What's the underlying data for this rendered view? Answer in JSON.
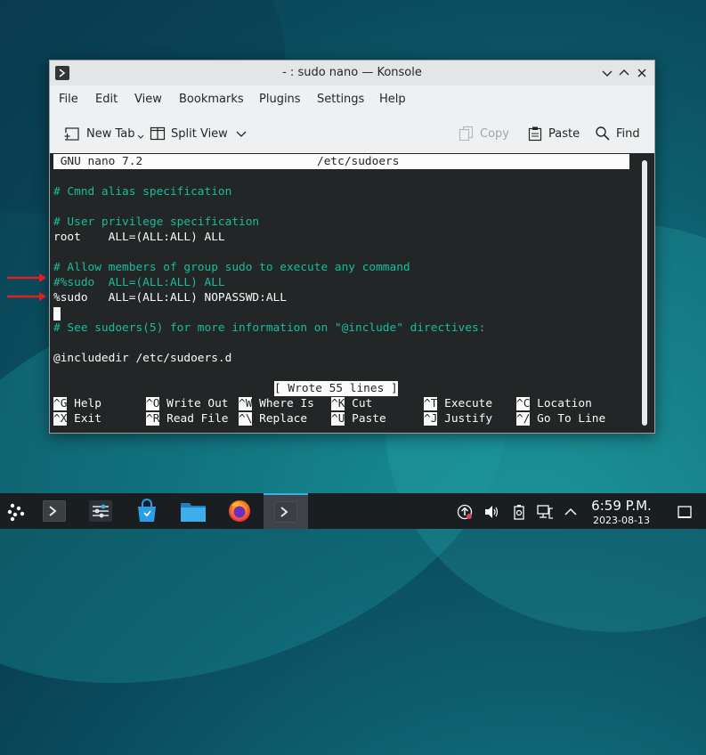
{
  "window": {
    "title": "- : sudo nano — Konsole"
  },
  "menu": [
    "File",
    "Edit",
    "View",
    "Bookmarks",
    "Plugins",
    "Settings",
    "Help"
  ],
  "toolbar": {
    "new_tab": "New Tab",
    "split_view": "Split View",
    "copy": "Copy",
    "paste": "Paste",
    "find": "Find"
  },
  "terminal": {
    "header_left": "GNU nano 7.2",
    "header_file": "/etc/sudoers",
    "lines": [
      {
        "text": "# Cmnd alias specification",
        "type": "comment"
      },
      {
        "text": "# User privilege specification",
        "type": "comment"
      },
      {
        "text": "root    ALL=(ALL:ALL) ALL",
        "type": "normal"
      },
      {
        "text": "# Allow members of group sudo to execute any command",
        "type": "comment"
      },
      {
        "text": "#%sudo  ALL=(ALL:ALL) ALL",
        "type": "comment"
      },
      {
        "text": "%sudo   ALL=(ALL:ALL) NOPASSWD:ALL",
        "type": "normal"
      },
      {
        "text": "# See sudoers(5) for more information on \"@include\" directives:",
        "type": "comment"
      },
      {
        "text": "@includedir /etc/sudoers.d",
        "type": "normal"
      }
    ],
    "status": "[ Wrote 55 lines ]",
    "shortcuts_row1": [
      {
        "key": "^G",
        "label": "Help"
      },
      {
        "key": "^O",
        "label": "Write Out"
      },
      {
        "key": "^W",
        "label": "Where Is"
      },
      {
        "key": "^K",
        "label": "Cut"
      },
      {
        "key": "^T",
        "label": "Execute"
      },
      {
        "key": "^C",
        "label": "Location"
      }
    ],
    "shortcuts_row2": [
      {
        "key": "^X",
        "label": "Exit"
      },
      {
        "key": "^R",
        "label": "Read File"
      },
      {
        "key": "^\\",
        "label": "Replace"
      },
      {
        "key": "^U",
        "label": "Paste"
      },
      {
        "key": "^J",
        "label": "Justify"
      },
      {
        "key": "^/",
        "label": "Go To Line"
      }
    ]
  },
  "taskbar": {
    "time": "6:59 P.M.",
    "date": "2023-08-13",
    "apps": [
      "application-launcher-icon",
      "konsole-icon",
      "system-settings-icon",
      "discover-store-icon",
      "dolphin-files-icon",
      "firefox-icon",
      "konsole-active-icon"
    ]
  },
  "colors": {
    "comment": "#1abc9c",
    "accent": "#3daee9",
    "terminal_bg": "#232627",
    "arrow": "#e02020"
  }
}
